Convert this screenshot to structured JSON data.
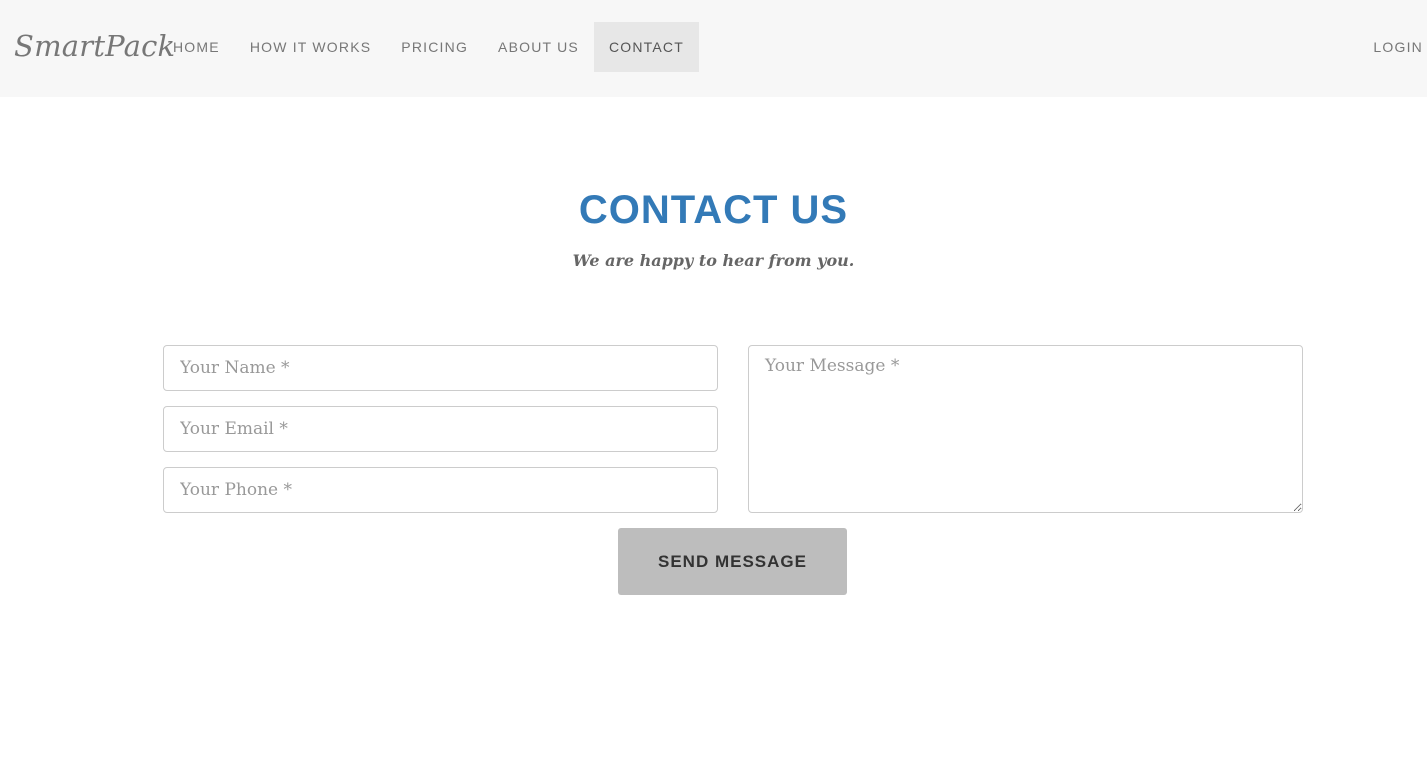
{
  "navbar": {
    "brand": "SmartPack",
    "items": [
      {
        "label": "HOME",
        "active": false
      },
      {
        "label": "HOW IT WORKS",
        "active": false
      },
      {
        "label": "PRICING",
        "active": false
      },
      {
        "label": "ABOUT US",
        "active": false
      },
      {
        "label": "CONTACT",
        "active": true
      }
    ],
    "login_label": "LOGIN"
  },
  "contact": {
    "title": "CONTACT US",
    "subtitle": "We are happy to hear from you.",
    "form": {
      "name_placeholder": "Your Name *",
      "email_placeholder": "Your Email *",
      "phone_placeholder": "Your Phone *",
      "message_placeholder": "Your Message *",
      "name_value": "",
      "email_value": "",
      "phone_value": "",
      "message_value": "",
      "submit_label": "SEND MESSAGE"
    }
  },
  "colors": {
    "accent": "#337ab7",
    "navbar_bg": "#f7f7f7",
    "active_nav_bg": "#e7e7e7",
    "button_bg": "#bdbdbd"
  }
}
